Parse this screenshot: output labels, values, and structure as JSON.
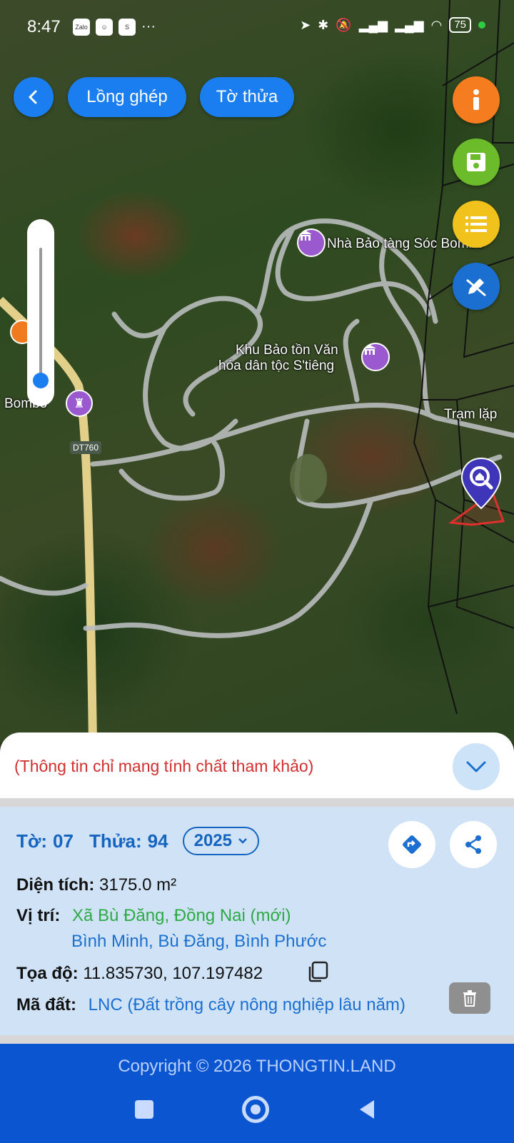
{
  "status_bar": {
    "time": "8:47",
    "app_icons": [
      "zalo-icon",
      "smile-icon",
      "shopee-icon"
    ],
    "more": "···",
    "battery": "75"
  },
  "toolbar": {
    "back_label": "<",
    "overlay_label": "Lồng ghép",
    "parcel_sheet_label": "Tờ thửa"
  },
  "right_buttons": [
    "info-button",
    "save-button",
    "list-button",
    "edit-button"
  ],
  "map": {
    "poi": [
      "Nhà Bảo tàng Sóc Bombo",
      "Khu Bảo tồn Văn",
      "hóa dân tộc S'tiêng",
      "Bombo",
      "Trạm lặp",
      "DT760"
    ]
  },
  "sheet": {
    "notice": "(Thông tin chỉ mang tính chất tham khảo)",
    "to_label": "Tờ:",
    "to_value": "07",
    "thua_label": "Thửa:",
    "thua_value": "94",
    "year": "2025",
    "area_label": "Diện tích:",
    "area_value": "3175.0 m²",
    "location_label": "Vị trí:",
    "location_new": "Xã Bù Đăng, Đồng Nai (mới)",
    "location_old": "Bình Minh, Bù Đăng, Bình Phước",
    "coords_label": "Tọa độ:",
    "coords_value": "11.835730, 107.197482",
    "land_code_label": "Mã đất:",
    "land_code_value": "LNC (Đất trồng cây nông nghiệp lâu năm)"
  },
  "footer": {
    "copyright": "Copyright © 2026 THONGTIN.LAND"
  },
  "colors": {
    "primary": "#1a7ef0",
    "footer": "#0b56d0",
    "info_orange": "#f57c1f",
    "save_green": "#6cbb2a",
    "list_yellow": "#f2c21c",
    "notice_red": "#d32f2f"
  }
}
